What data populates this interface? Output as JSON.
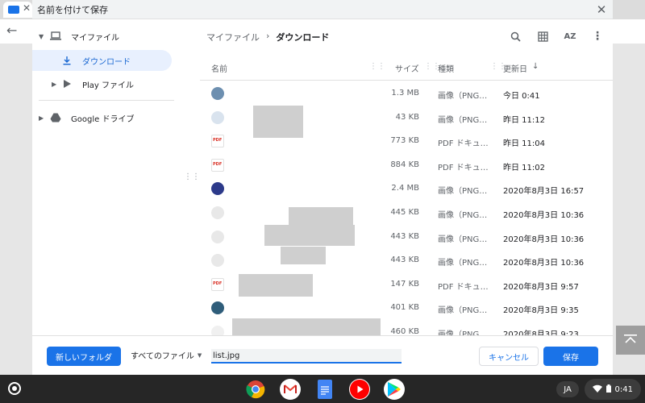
{
  "dialog": {
    "title": "名前を付けて保存",
    "close_label": "✕"
  },
  "sidebar": {
    "items": [
      {
        "label": "マイファイル",
        "icon": "laptop-icon",
        "expanded": true
      },
      {
        "label": "ダウンロード",
        "icon": "download-icon",
        "active": true
      },
      {
        "label": "Play ファイル",
        "icon": "play-store-icon"
      },
      {
        "label": "Google ドライブ",
        "icon": "google-drive-icon"
      }
    ]
  },
  "breadcrumb": {
    "root": "マイファイル",
    "separator": "›",
    "current": "ダウンロード"
  },
  "toolbar": {
    "search_icon": "search-icon",
    "grid_icon": "grid-view-icon",
    "sort_label": "AZ",
    "more_icon": "more-vert-icon"
  },
  "columns": {
    "name": "名前",
    "size": "サイズ",
    "type": "種類",
    "date": "更新日",
    "sort_arrow": "↓"
  },
  "files": [
    {
      "size": "1.3 MB",
      "type": "画像（PNG…",
      "date": "今日 0:41",
      "kind": "image"
    },
    {
      "size": "43 KB",
      "type": "画像（PNG…",
      "date": "昨日 11:12",
      "kind": "image"
    },
    {
      "size": "773 KB",
      "type": "PDF ドキュ…",
      "date": "昨日 11:04",
      "kind": "pdf"
    },
    {
      "size": "884 KB",
      "type": "PDF ドキュ…",
      "date": "昨日 11:02",
      "kind": "pdf"
    },
    {
      "size": "2.4 MB",
      "type": "画像（PNG…",
      "date": "2020年8月3日 16:57",
      "kind": "image"
    },
    {
      "size": "445 KB",
      "type": "画像（PNG…",
      "date": "2020年8月3日 10:36",
      "kind": "image"
    },
    {
      "size": "443 KB",
      "type": "画像（PNG…",
      "date": "2020年8月3日 10:36",
      "kind": "image"
    },
    {
      "size": "443 KB",
      "type": "画像（PNG…",
      "date": "2020年8月3日 10:36",
      "kind": "image"
    },
    {
      "size": "147 KB",
      "type": "PDF ドキュ…",
      "date": "2020年8月3日 9:57",
      "kind": "pdf"
    },
    {
      "size": "401 KB",
      "type": "画像（PNG…",
      "date": "2020年8月3日 9:35",
      "kind": "image"
    },
    {
      "size": "460 KB",
      "type": "画像（PNG…",
      "date": "2020年8月3日 9:23",
      "kind": "image"
    }
  ],
  "bottom": {
    "new_folder": "新しいフォルダ",
    "filter": "すべてのファイル",
    "filename_value": "list.jpg",
    "cancel": "キャンセル",
    "save": "保存"
  },
  "shelf": {
    "apps": [
      "chrome-icon",
      "gmail-icon",
      "google-docs-icon",
      "youtube-icon",
      "play-store-icon"
    ],
    "ime": "JA",
    "time": "0:41"
  },
  "colors": {
    "accent": "#1a73e8",
    "active_bg": "#e8f0fe"
  }
}
